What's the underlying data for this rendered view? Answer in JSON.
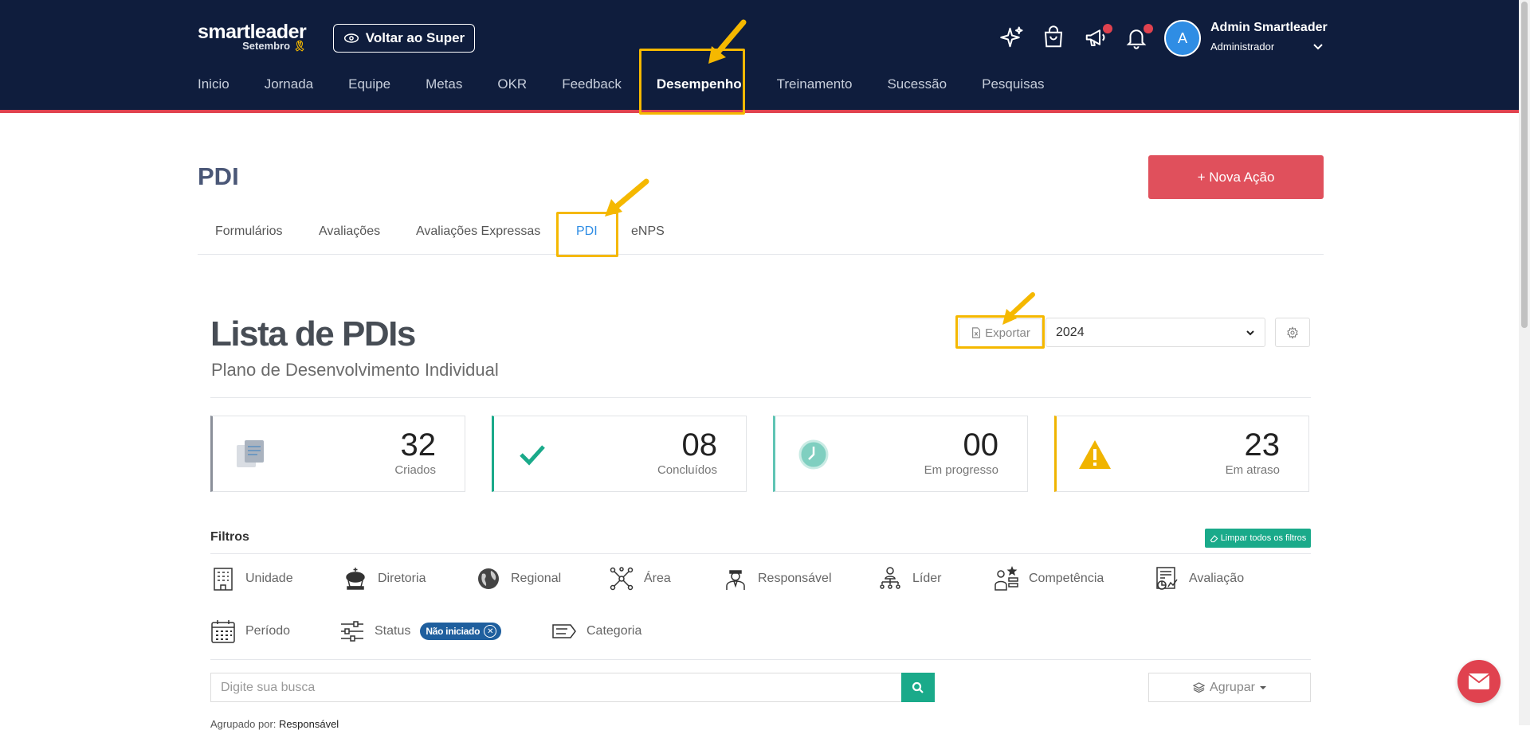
{
  "header": {
    "brand": "smartleader",
    "brand_sub": "Setembro",
    "back_button": "Voltar ao Super",
    "nav": [
      "Inicio",
      "Jornada",
      "Equipe",
      "Metas",
      "OKR",
      "Feedback",
      "Desempenho",
      "Treinamento",
      "Sucessão",
      "Pesquisas"
    ],
    "active_nav": "Desempenho",
    "icons": [
      "sparkles-icon",
      "shopping-bag-icon",
      "megaphone-icon",
      "bell-icon"
    ],
    "user": {
      "initial": "A",
      "name": "Admin Smartleader",
      "role": "Administrador"
    }
  },
  "page": {
    "title": "PDI",
    "new_action_button": "+ Nova Ação",
    "tabs": [
      "Formulários",
      "Avaliações",
      "Avaliações Expressas",
      "PDI",
      "eNPS"
    ],
    "active_tab": "PDI"
  },
  "list": {
    "title": "Lista de PDIs",
    "subtitle": "Plano de Desenvolvimento Individual",
    "export_button": "Exportar",
    "year": "2024"
  },
  "stats": [
    {
      "value": "32",
      "label": "Criados",
      "color": "#8a8f99"
    },
    {
      "value": "08",
      "label": "Concluídos",
      "color": "#1aaa8a"
    },
    {
      "value": "00",
      "label": "Em progresso",
      "color": "#5fc4b4"
    },
    {
      "value": "23",
      "label": "Em atraso",
      "color": "#f0b400"
    }
  ],
  "filters": {
    "title": "Filtros",
    "clear_button": "Limpar todos os filtros",
    "row1": [
      "Unidade",
      "Diretoria",
      "Regional",
      "Área",
      "Responsável",
      "Líder",
      "Competência",
      "Avaliação"
    ],
    "row2": [
      "Período",
      "Status",
      "Categoria"
    ],
    "status_badge": "Não iniciado"
  },
  "search": {
    "placeholder": "Digite sua busca",
    "group_button": "Agrupar",
    "grouped_by_label": "Agrupado por:",
    "grouped_by_value": "Responsável"
  },
  "colors": {
    "topbar": "#0f1d3d",
    "accent_red": "#e0424f",
    "highlight": "#f5b800",
    "teal": "#1aaa8a",
    "link_blue": "#2f8de4"
  }
}
